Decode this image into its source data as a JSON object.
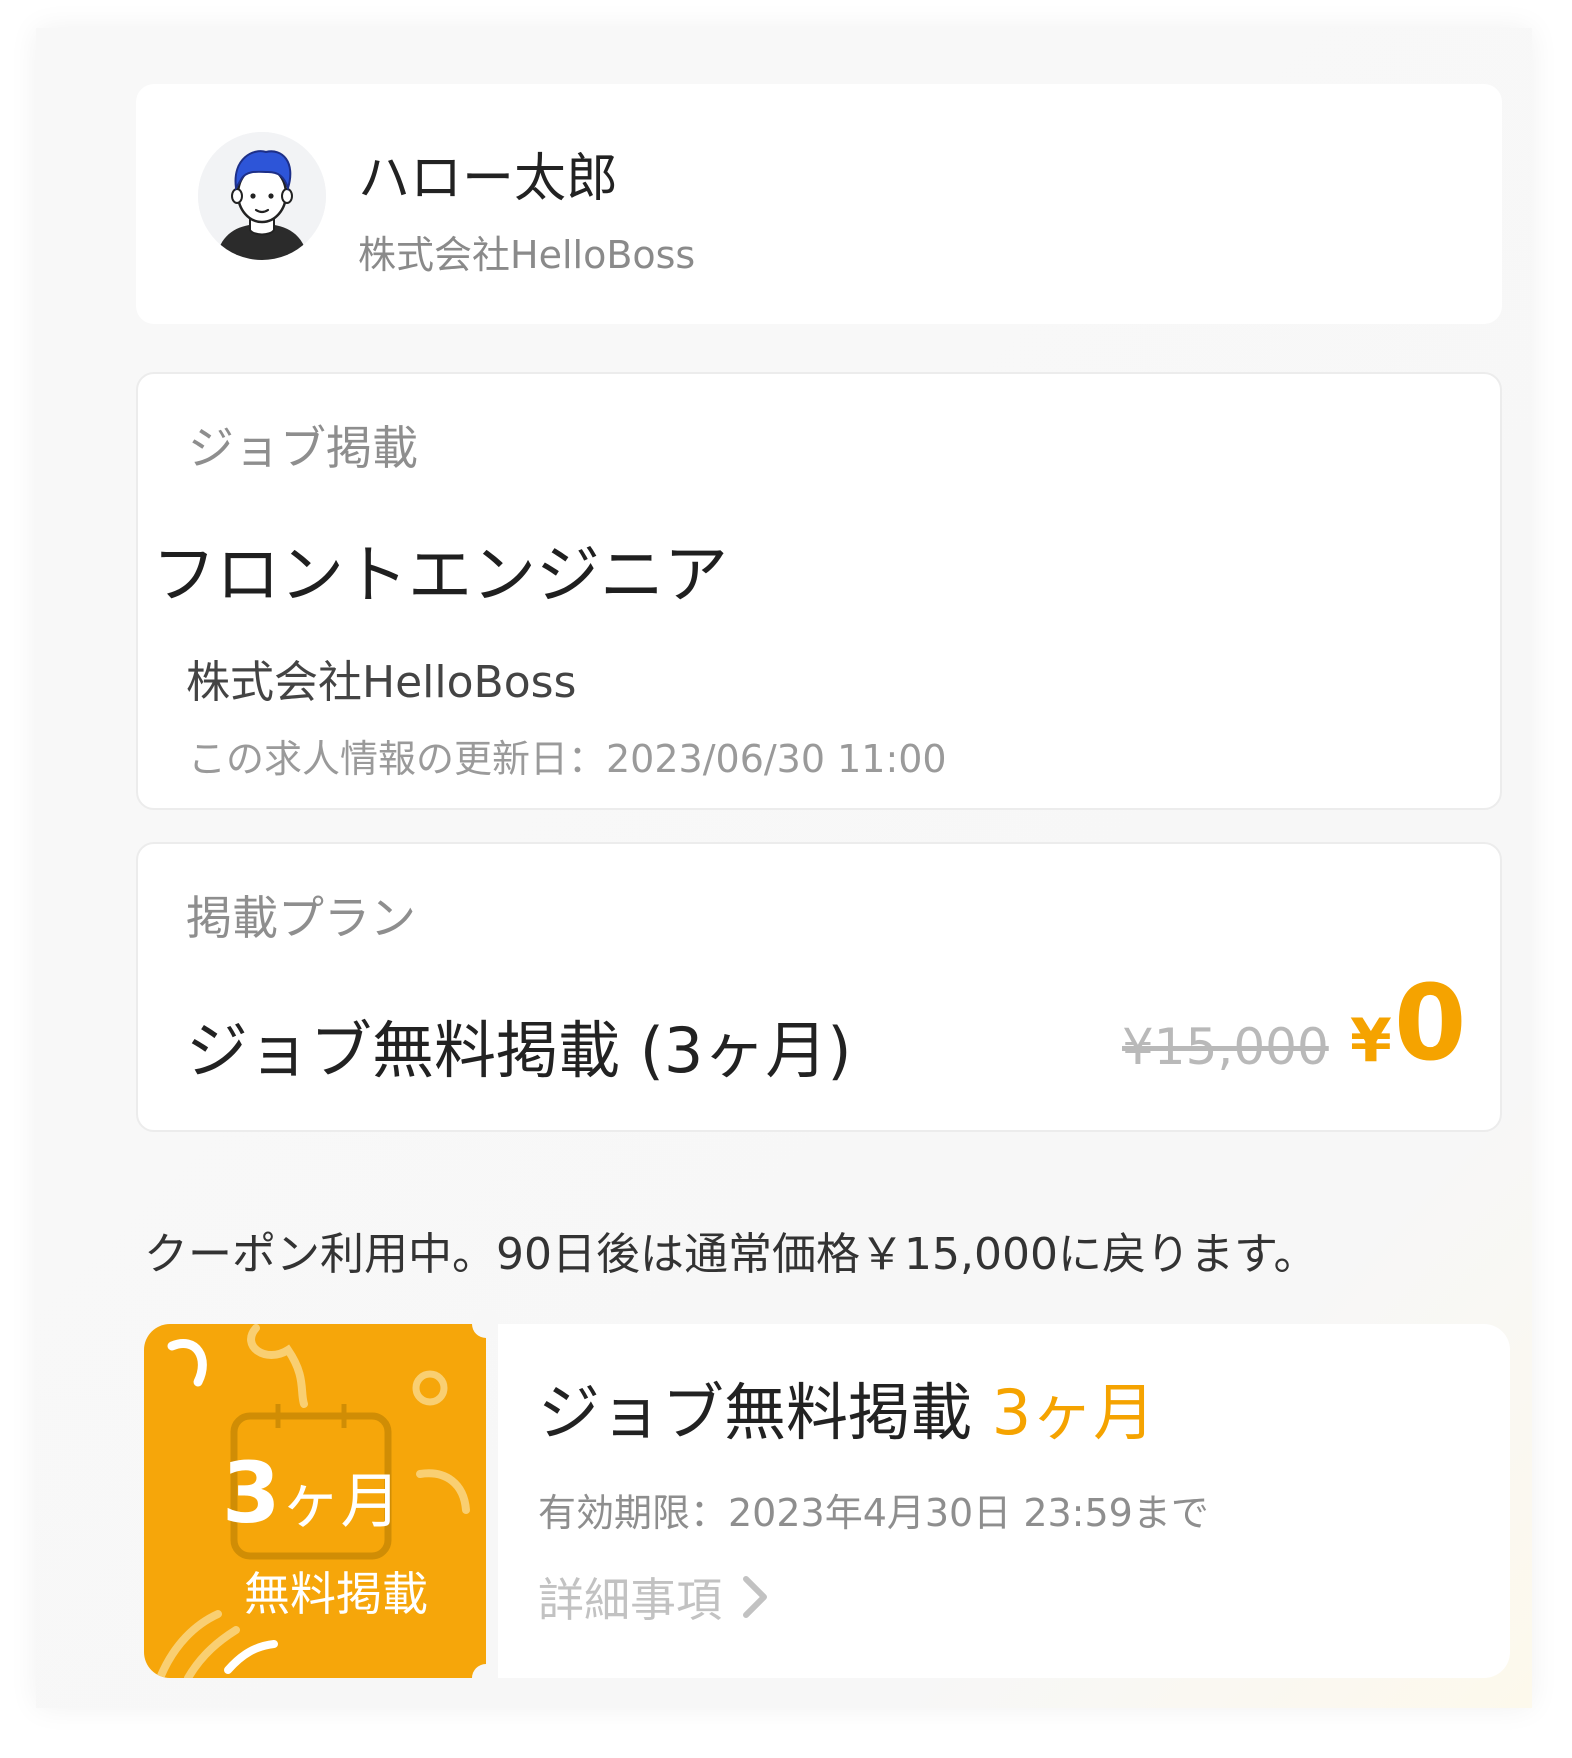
{
  "profile": {
    "name": "ハロー太郎",
    "company": "株式会社HelloBoss"
  },
  "job": {
    "section_label": "ジョブ掲載",
    "title": "フロントエンジニア",
    "company": "株式会社HelloBoss",
    "updated": "この求人情報の更新日：2023/06/30 11:00"
  },
  "plan": {
    "section_label": "掲載プラン",
    "name": "ジョブ無料掲載 (3ヶ月)",
    "original_price": "¥15,000",
    "currency": "¥",
    "price": "0"
  },
  "coupon_note": "クーポン利用中。90日後は通常価格￥15,000に戻ります。",
  "coupon": {
    "badge_number": "3",
    "badge_unit": "ヶ月",
    "badge_label": "無料掲載",
    "title": "ジョブ無料掲載",
    "title_accent": "3ヶ月",
    "validity": "有効期限：2023年4月30日 23:59まで",
    "details_label": "詳細事項"
  },
  "colors": {
    "accent": "#f5a300",
    "ticket": "#f6a60a",
    "background": "#f7f7f7"
  },
  "icons": [
    "avatar",
    "calendar-icon",
    "chevron-right-icon"
  ]
}
